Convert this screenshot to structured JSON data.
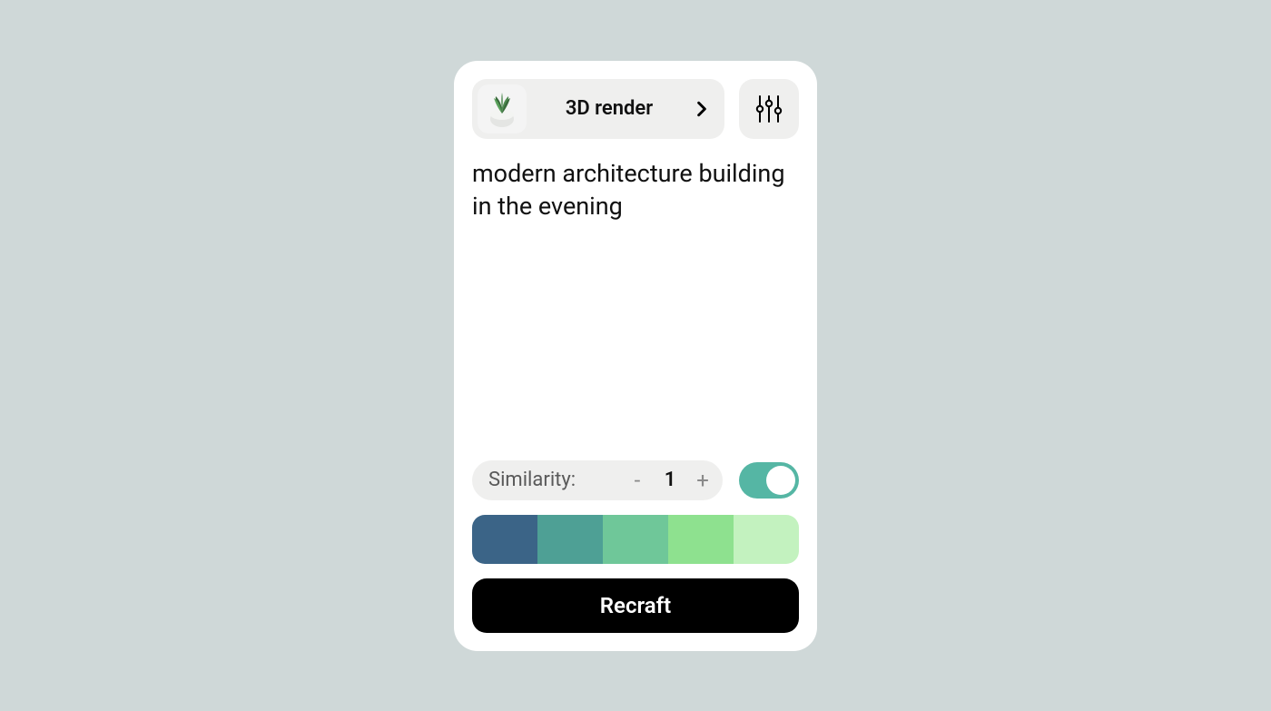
{
  "style_chip": {
    "label": "3D render",
    "thumb_alt": "plant-pot-thumbnail"
  },
  "prompt": "modern architecture building in the evening",
  "similarity": {
    "label": "Similarity:",
    "minus": "-",
    "value": "1",
    "plus": "+"
  },
  "toggle": {
    "on": true
  },
  "palette": [
    "#3b6487",
    "#4ea095",
    "#6fc799",
    "#8ee18f",
    "#c3f2bf"
  ],
  "primary_button": "Recraft"
}
